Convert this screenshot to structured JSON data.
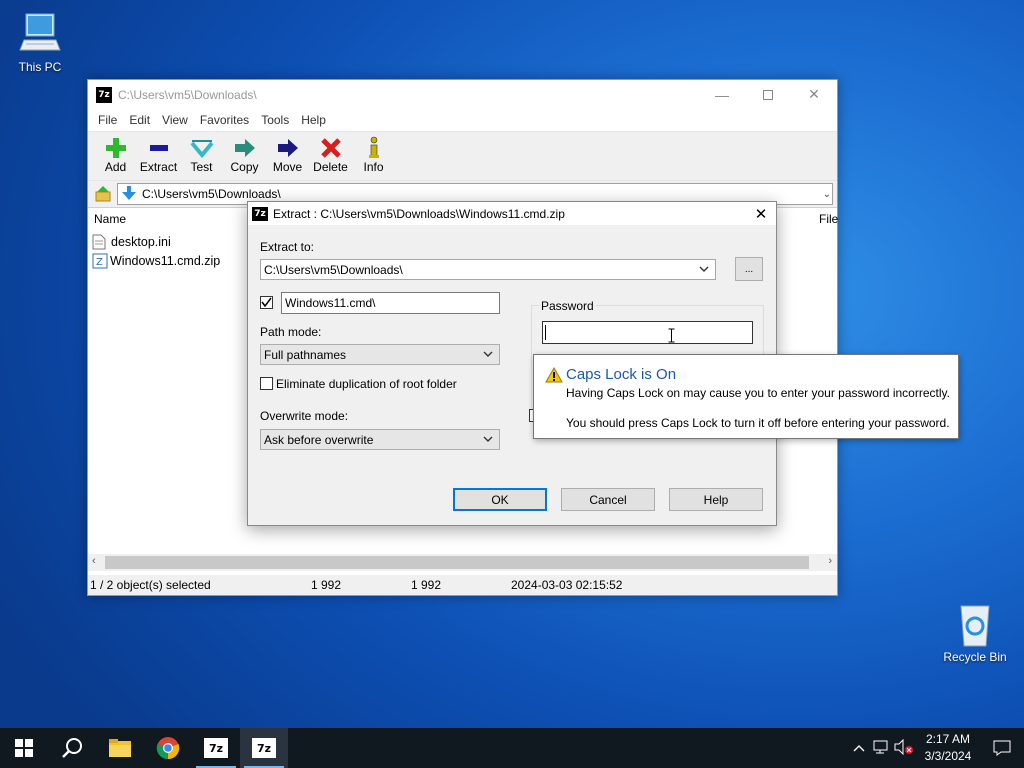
{
  "desktop": {
    "this_pc": "This PC",
    "recycle_bin": "Recycle Bin"
  },
  "main_window": {
    "title": "C:\\Users\\vm5\\Downloads\\",
    "app_icon_text": "7z",
    "menu": [
      "File",
      "Edit",
      "View",
      "Favorites",
      "Tools",
      "Help"
    ],
    "toolbar": [
      {
        "label": "Add",
        "icon": "plus-icon",
        "color": "#2db82d"
      },
      {
        "label": "Extract",
        "icon": "minus-icon",
        "color": "#1a1a9c"
      },
      {
        "label": "Test",
        "icon": "check-icon",
        "color": "#35b9c8"
      },
      {
        "label": "Copy",
        "icon": "double-arrow-icon",
        "color": "#2a8c7a"
      },
      {
        "label": "Move",
        "icon": "arrow-right-icon",
        "color": "#1a1a80"
      },
      {
        "label": "Delete",
        "icon": "x-icon",
        "color": "#d81e1e"
      },
      {
        "label": "Info",
        "icon": "info-icon",
        "color": "#c8b400"
      }
    ],
    "address": "C:\\Users\\vm5\\Downloads\\",
    "columns": {
      "name": "Name",
      "file": "File"
    },
    "files": [
      "desktop.ini",
      "Windows11.cmd.zip"
    ],
    "status": {
      "selected": "1 / 2 object(s) selected",
      "size": "1 992",
      "packed": "1 992",
      "modified": "2024-03-03 02:15:52"
    }
  },
  "extract_dialog": {
    "title": "Extract : C:\\Users\\vm5\\Downloads\\Windows11.cmd.zip",
    "app_icon_text": "7z",
    "extract_to_label": "Extract to:",
    "extract_to_value": "C:\\Users\\vm5\\Downloads\\",
    "browse_label": "...",
    "subfolder_value": "Windows11.cmd\\",
    "path_mode_label": "Path mode:",
    "path_mode_value": "Full pathnames",
    "eliminate_label": "Eliminate duplication of root folder",
    "overwrite_label": "Overwrite mode:",
    "overwrite_value": "Ask before overwrite",
    "password_label": "Password",
    "password_value": "",
    "ok_label": "OK",
    "cancel_label": "Cancel",
    "help_label": "Help"
  },
  "tooltip": {
    "title": "Caps Lock is On",
    "line1": "Having Caps Lock on may cause you to enter your password incorrectly.",
    "line2": "You should press Caps Lock to turn it off before entering your password.",
    "title_color": "#1c5aa8"
  },
  "taskbar": {
    "time": "2:17 AM",
    "date": "3/3/2024",
    "zip_label": "7z"
  }
}
